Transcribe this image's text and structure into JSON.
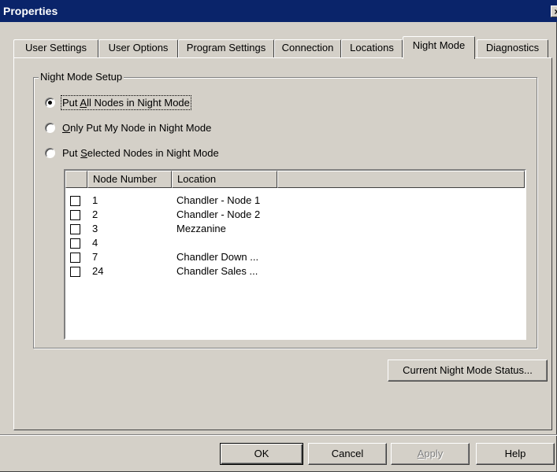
{
  "window": {
    "title": "Properties",
    "close_glyph": "×"
  },
  "tabs": [
    {
      "label": "User Settings",
      "active": false
    },
    {
      "label": "User Options",
      "active": false
    },
    {
      "label": "Program Settings",
      "active": false
    },
    {
      "label": "Connection",
      "active": false
    },
    {
      "label": "Locations",
      "active": false
    },
    {
      "label": "Night Mode",
      "active": true
    },
    {
      "label": "Diagnostics",
      "active": false
    }
  ],
  "group": {
    "legend": "Night Mode Setup",
    "radios": [
      {
        "pre": "Put ",
        "accel": "A",
        "post": "ll Nodes in Night Mode",
        "checked": true
      },
      {
        "pre": "",
        "accel": "O",
        "post": "nly Put My Node in Night Mode",
        "checked": false
      },
      {
        "pre": "Put ",
        "accel": "S",
        "post": "elected Nodes in Night Mode",
        "checked": false
      }
    ]
  },
  "nodes": {
    "columns": [
      "",
      "Node Number",
      "Location",
      ""
    ],
    "rows": [
      {
        "number": "1",
        "location": "Chandler - Node 1",
        "checked": false
      },
      {
        "number": "2",
        "location": "Chandler - Node 2",
        "checked": false
      },
      {
        "number": "3",
        "location": "Mezzanine",
        "checked": false
      },
      {
        "number": "4",
        "location": "",
        "checked": false
      },
      {
        "number": "7",
        "location": "Chandler Down ...",
        "checked": false
      },
      {
        "number": "24",
        "location": "Chandler Sales ...",
        "checked": false
      }
    ]
  },
  "status_button": "Current Night Mode Status...",
  "buttons": {
    "ok": "OK",
    "cancel": "Cancel",
    "apply_accel": "A",
    "apply_rest": "pply",
    "help": "Help"
  },
  "colors": {
    "titlebar": "#0a246a",
    "face": "#d4d0c8",
    "disabled_text": "#808080"
  }
}
